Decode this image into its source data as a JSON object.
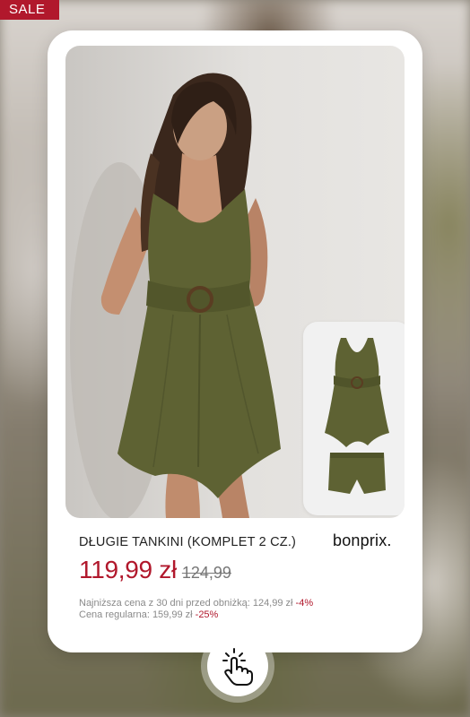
{
  "badge": {
    "label": "SALE"
  },
  "product": {
    "name": "DŁUGIE TANKINI (KOMPLET 2 CZ.)",
    "brand": "bonprix.",
    "price_current": "119,99 zł",
    "price_old": "124,99",
    "lowest_price_label": "Najniższa cena z 30 dni przed obniżką: 124,99 zł",
    "lowest_price_discount": "-4%",
    "regular_price_label": "Cena regularna: 159,99 zł",
    "regular_price_discount": "-25%"
  },
  "colors": {
    "accent": "#b1182c",
    "product_olive": "#5e6233"
  },
  "icons": {
    "tap": "hand-tap-icon"
  }
}
